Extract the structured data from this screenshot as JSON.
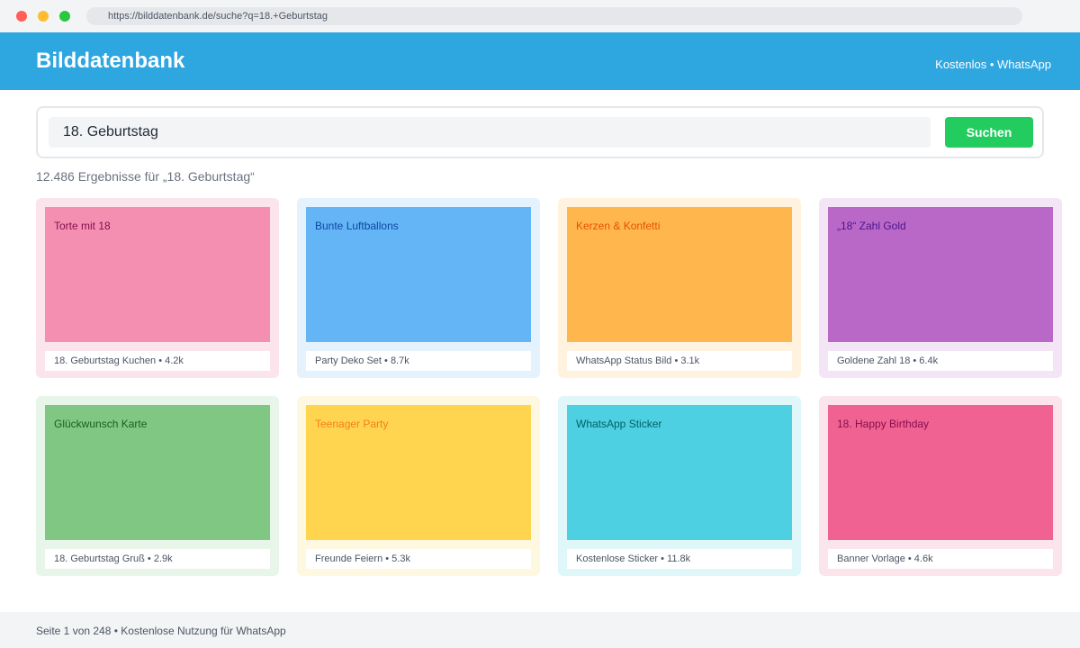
{
  "browser": {
    "url": "https://bilddatenbank.de/suche?q=18.+Geburtstag"
  },
  "header": {
    "brand": "Bilddatenbank",
    "links": "Kostenlos • WhatsApp"
  },
  "search": {
    "value": "18. Geburtstag",
    "button_label": "Suchen"
  },
  "results_summary": "12.486 Ergebnisse für „18. Geburtstag“",
  "cards": [
    {
      "title": "Torte mit 18",
      "caption": "18. Geburtstag Kuchen • 4.2k",
      "color": "#f48fb1",
      "title_color": "#880e4f",
      "bg": "#fce4ec"
    },
    {
      "title": "Bunte Luftballons",
      "caption": "Party Deko Set • 8.7k",
      "color": "#64b5f6",
      "title_color": "#0d47a1",
      "bg": "#e3f2fd"
    },
    {
      "title": "Kerzen & Konfetti",
      "caption": "WhatsApp Status Bild • 3.1k",
      "color": "#ffb74d",
      "title_color": "#e65100",
      "bg": "#fff3e0"
    },
    {
      "title": "„18“ Zahl Gold",
      "caption": "Goldene Zahl 18 • 6.4k",
      "color": "#ba68c8",
      "title_color": "#4a148c",
      "bg": "#f3e5f5"
    },
    {
      "title": "Glückwunsch Karte",
      "caption": "18. Geburtstag Gruß • 2.9k",
      "color": "#81c784",
      "title_color": "#1b5e20",
      "bg": "#e8f5e9"
    },
    {
      "title": "Teenager Party",
      "caption": "Freunde Feiern • 5.3k",
      "color": "#ffd54f",
      "title_color": "#f57f17",
      "bg": "#fff8e1"
    },
    {
      "title": "WhatsApp Sticker",
      "caption": "Kostenlose Sticker • 11.8k",
      "color": "#4dd0e1",
      "title_color": "#006064",
      "bg": "#e0f7fa"
    },
    {
      "title": "18. Happy Birthday",
      "caption": "Banner Vorlage • 4.6k",
      "color": "#f06292",
      "title_color": "#880e4f",
      "bg": "#fce4ec"
    }
  ],
  "footer": {
    "text": "Seite 1 von 248 • Kostenlose Nutzung für WhatsApp"
  }
}
